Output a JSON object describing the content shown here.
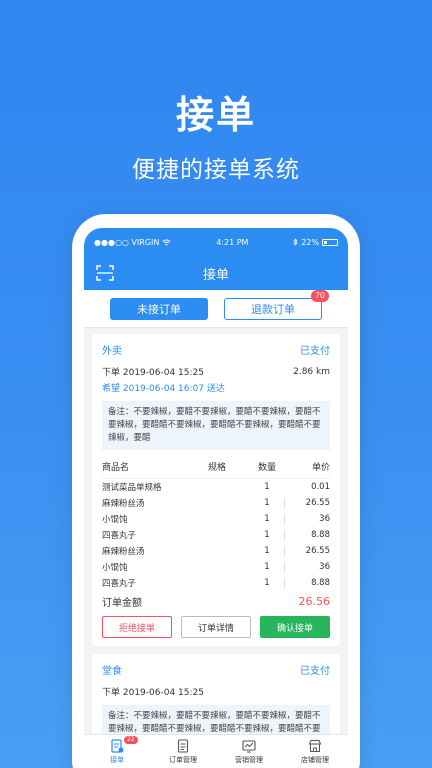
{
  "hero": {
    "title": "接单",
    "subtitle": "便捷的接单系统"
  },
  "status_bar": {
    "carrier": "●●●○○ VIRGIN",
    "time": "4:21 PM",
    "battery": "22%"
  },
  "nav": {
    "title": "接单"
  },
  "tabs": [
    {
      "label": "未接订单",
      "active": true
    },
    {
      "label": "退款订单",
      "badge": "70"
    }
  ],
  "order1": {
    "type": "外卖",
    "status": "已支付",
    "placed": "下单 2019-06-04 15:25",
    "distance": "2.86 km",
    "expect": "希望 2019-06-04 16:07 送达",
    "note": "备注：不要辣椒，要醋不要辣椒，要醋不要辣椒，要醋不要辣椒，要醋醋不要辣椒，要醋醋不要辣椒，要醋醋不要辣椒，要醋",
    "headers": {
      "name": "商品名",
      "spec": "规格",
      "qty": "数量",
      "price": "单价"
    },
    "items": [
      {
        "name": "测试菜品单规格",
        "qty": "1",
        "price": "0.01"
      },
      {
        "name": "麻辣粉丝汤",
        "qty": "1",
        "price": "26.55"
      },
      {
        "name": "小馄饨",
        "qty": "1",
        "price": "36"
      },
      {
        "name": "四喜丸子",
        "qty": "1",
        "price": "8.88"
      },
      {
        "name": "麻辣粉丝汤",
        "qty": "1",
        "price": "26.55"
      },
      {
        "name": "小馄饨",
        "qty": "1",
        "price": "36"
      },
      {
        "name": "四喜丸子",
        "qty": "1",
        "price": "8.88"
      }
    ],
    "total_label": "订单金额",
    "total_value": "26.56",
    "actions": {
      "reject": "拒绝接单",
      "detail": "订单详情",
      "confirm": "确认接单"
    }
  },
  "order2": {
    "type": "堂食",
    "status": "已支付",
    "placed": "下单 2019-06-04 15:25",
    "note": "备注：不要辣椒，要醋不要辣椒，要醋不要辣椒，要醋不要辣椒，要醋醋不要辣椒，要醋醋不要辣椒，要醋醋不要辣椒，要"
  },
  "tabbar": {
    "items": [
      {
        "label": "接单",
        "badge": "22",
        "icon": "order-receive-icon"
      },
      {
        "label": "订单管理",
        "icon": "order-list-icon"
      },
      {
        "label": "营销管理",
        "icon": "marketing-icon"
      },
      {
        "label": "店铺管理",
        "icon": "store-icon"
      }
    ]
  },
  "colors": {
    "primary": "#2b8cf2",
    "danger": "#f5515f",
    "success": "#29b55b"
  }
}
